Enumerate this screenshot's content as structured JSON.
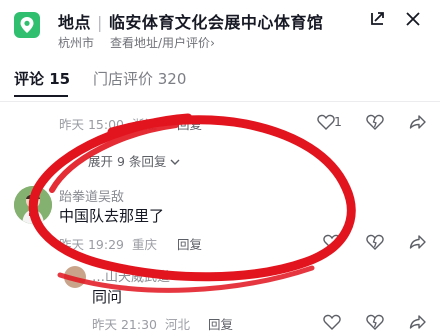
{
  "header": {
    "kind": "地点",
    "name": "临安体育文化会展中心体育馆",
    "city": "杭州市",
    "link": "查看地址/用户评价",
    "link_chevron": "›",
    "icons": [
      "location-pin-icon",
      "minimize-icon",
      "close-icon"
    ]
  },
  "tabs": [
    {
      "label": "评论 15",
      "active": true
    },
    {
      "label": "门店评价 320",
      "active": false
    }
  ],
  "comments": [
    {
      "time": "昨天 15:00",
      "location": "浙江",
      "reply": "回复",
      "likes": "1",
      "expand": "展开 9 条回复"
    },
    {
      "user": "跆拳道吴敌",
      "text": "中国队去那里了",
      "time": "昨天 19:29",
      "location": "重庆",
      "reply": "回复"
    },
    {
      "user": "…山天威武道",
      "text": "同问",
      "time": "昨天 21:30",
      "location": "河北",
      "reply": "回复"
    }
  ],
  "accent_colors": {
    "location_tile": "#2fbf6e",
    "annotation_circle": "#e2141e"
  }
}
